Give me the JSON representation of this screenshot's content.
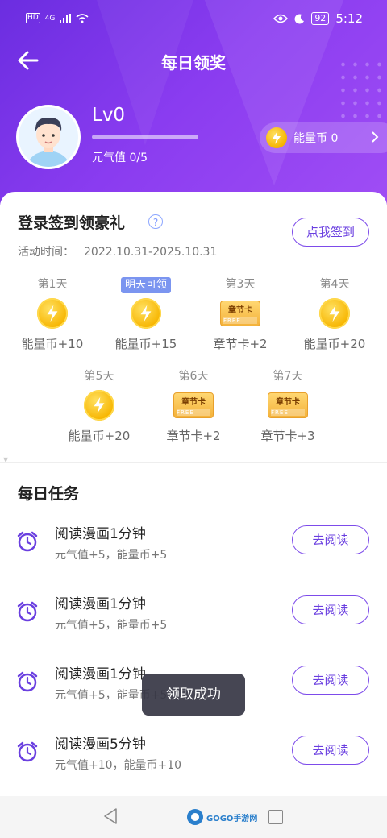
{
  "status_bar": {
    "hd": "HD",
    "network": "4G",
    "battery": "92",
    "time": "5:12"
  },
  "header": {
    "title": "每日领奖"
  },
  "profile": {
    "level": "Lv0",
    "level_progress": 0,
    "vitality": "元气值 0/5"
  },
  "energy": {
    "label": "能量币 0"
  },
  "checkin": {
    "title": "登录签到领豪礼",
    "period_label": "活动时间：",
    "period": "2022.10.31-2025.10.31",
    "button": "点我签到",
    "rewards": [
      {
        "day": "第1天",
        "type": "coin",
        "amount": "能量币+10"
      },
      {
        "day": "明天可领",
        "type": "coin",
        "amount": "能量币+15",
        "highlight": true
      },
      {
        "day": "第3天",
        "type": "ticket",
        "amount": "章节卡+2"
      },
      {
        "day": "第4天",
        "type": "coin",
        "amount": "能量币+20"
      },
      {
        "day": "第5天",
        "type": "coin",
        "amount": "能量币+20"
      },
      {
        "day": "第6天",
        "type": "ticket",
        "amount": "章节卡+2"
      },
      {
        "day": "第7天",
        "type": "ticket",
        "amount": "章节卡+3"
      }
    ],
    "ticket_label": "章节卡",
    "ticket_sub": "FREE"
  },
  "tasks": {
    "title": "每日任务",
    "items": [
      {
        "name": "阅读漫画1分钟",
        "desc": "元气值+5，能量币+5",
        "button": "去阅读"
      },
      {
        "name": "阅读漫画1分钟",
        "desc": "元气值+5，能量币+5",
        "button": "去阅读"
      },
      {
        "name": "阅读漫画1分钟",
        "desc": "元气值+5，能量币+5",
        "button": "去阅读"
      },
      {
        "name": "阅读漫画5分钟",
        "desc": "元气值+10，能量币+10",
        "button": "去阅读"
      }
    ]
  },
  "toast": "领取成功",
  "watermark": "GOGO手游网",
  "colors": {
    "accent": "#7b3ee8",
    "header_start": "#6b2de0",
    "header_end": "#a24ff5",
    "coin": "#f7b500"
  }
}
